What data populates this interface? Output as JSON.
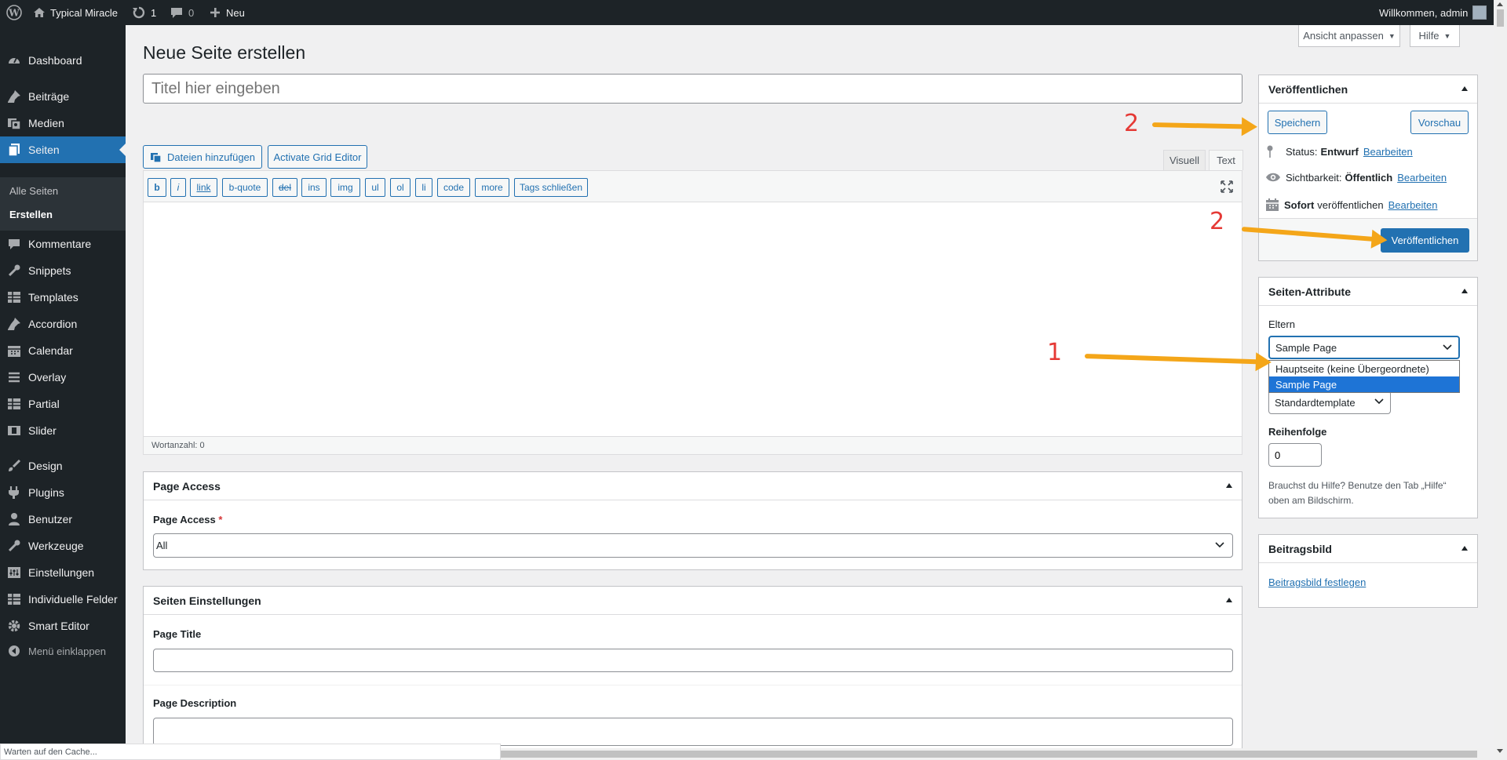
{
  "admin_bar": {
    "site_name": "Typical Miracle",
    "updates_count": "1",
    "comments_count": "0",
    "new_label": "Neu",
    "welcome": "Willkommen, admin"
  },
  "sidebar": {
    "items": [
      {
        "label": "Dashboard",
        "icon": "dashboard-icon"
      },
      {
        "label": "Beiträge",
        "icon": "pin-icon"
      },
      {
        "label": "Medien",
        "icon": "media-icon"
      },
      {
        "label": "Seiten",
        "icon": "pages-icon"
      },
      {
        "label": "Kommentare",
        "icon": "comment-icon"
      },
      {
        "label": "Snippets",
        "icon": "wrench-icon"
      },
      {
        "label": "Templates",
        "icon": "grid-icon"
      },
      {
        "label": "Accordion",
        "icon": "pin-icon"
      },
      {
        "label": "Calendar",
        "icon": "calendar-icon"
      },
      {
        "label": "Overlay",
        "icon": "menu-icon"
      },
      {
        "label": "Partial",
        "icon": "grid-icon"
      },
      {
        "label": "Slider",
        "icon": "slider-icon"
      },
      {
        "label": "Design",
        "icon": "brush-icon"
      },
      {
        "label": "Plugins",
        "icon": "plug-icon"
      },
      {
        "label": "Benutzer",
        "icon": "user-icon"
      },
      {
        "label": "Werkzeuge",
        "icon": "wrench-icon"
      },
      {
        "label": "Einstellungen",
        "icon": "settings-icon"
      },
      {
        "label": "Individuelle Felder",
        "icon": "grid-icon"
      },
      {
        "label": "Smart Editor",
        "icon": "gear-icon"
      }
    ],
    "submenu": [
      "Alle Seiten",
      "Erstellen"
    ],
    "collapse": "Menü einklappen"
  },
  "top_buttons": {
    "screen_options": "Ansicht anpassen",
    "help": "Hilfe"
  },
  "page": {
    "heading": "Neue Seite erstellen",
    "title_placeholder": "Titel hier eingeben"
  },
  "editor": {
    "add_media": "Dateien hinzufügen",
    "grid_editor": "Activate Grid Editor",
    "tab_visual": "Visuell",
    "tab_text": "Text",
    "quicktags": [
      "b",
      "i",
      "link",
      "b-quote",
      "del",
      "ins",
      "img",
      "ul",
      "ol",
      "li",
      "code",
      "more",
      "Tags schließen"
    ],
    "word_count": "Wortanzahl: 0"
  },
  "page_access": {
    "title": "Page Access",
    "label": "Page Access",
    "required": "*",
    "value": "All"
  },
  "seo": {
    "title": "Seiten Einstellungen",
    "page_title_label": "Page Title",
    "page_description_label": "Page Description"
  },
  "publish": {
    "title": "Veröffentlichen",
    "save": "Speichern",
    "preview": "Vorschau",
    "status_label": "Status:",
    "status_value": "Entwurf",
    "edit": "Bearbeiten",
    "visibility_label": "Sichtbarkeit:",
    "visibility_value": "Öffentlich",
    "schedule_strong": "Sofort",
    "schedule_rest": "veröffentlichen",
    "publish_button": "Veröffentlichen"
  },
  "attributes": {
    "title": "Seiten-Attribute",
    "parent_label": "Eltern",
    "parent_selected": "Sample Page",
    "parent_options": [
      "Hauptseite (keine Übergeordnete)",
      "Sample Page"
    ],
    "template_value": "Standardtemplate",
    "order_label": "Reihenfolge",
    "order_value": "0",
    "help_text_1": "Brauchst du Hilfe? Benutze den Tab „Hilfe“",
    "help_text_2": "oben am Bildschirm."
  },
  "featured_image": {
    "title": "Beitragsbild",
    "link": "Beitragsbild festlegen"
  },
  "annotations": {
    "step_1": "1",
    "step_2": "2"
  },
  "status_bar": {
    "text": "Warten auf den Cache..."
  },
  "colors": {
    "admin_bar": "#1d2327",
    "accent": "#2271b1",
    "arrow": "#f4a619",
    "annotation_number": "#e53935"
  }
}
